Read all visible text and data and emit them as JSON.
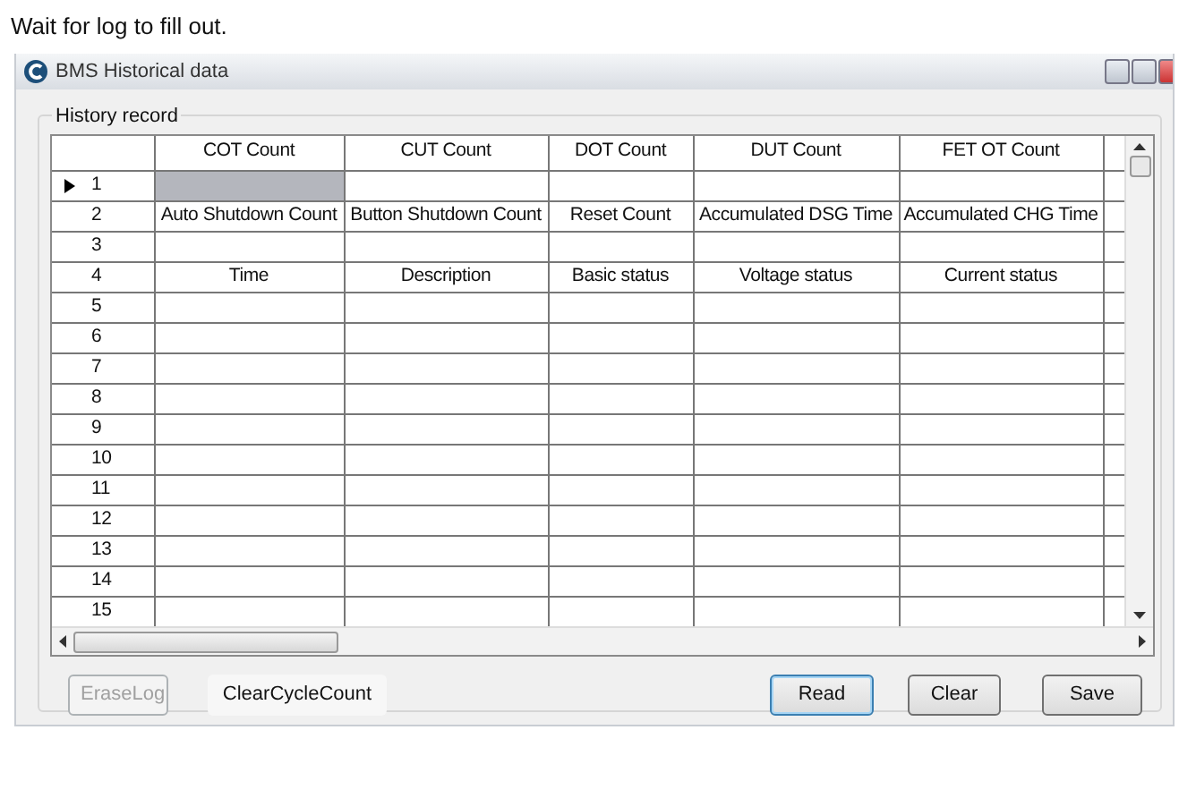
{
  "instruction": "Wait for log to fill out.",
  "window": {
    "title": "BMS Historical data"
  },
  "group": {
    "title": "History record"
  },
  "table": {
    "columns": [
      "COT Count",
      "CUT Count",
      "DOT Count",
      "DUT Count",
      "FET OT Count"
    ],
    "rows": [
      {
        "number": "1",
        "current": true
      },
      {
        "number": "2",
        "current": false,
        "cells": [
          "Auto Shutdown Count",
          "Button Shutdown Count",
          "Reset Count",
          "Accumulated DSG Time",
          "Accumulated CHG Time"
        ]
      },
      {
        "number": "3",
        "current": false
      },
      {
        "number": "4",
        "current": false,
        "cells": [
          "Time",
          "Description",
          "Basic status",
          "Voltage status",
          "Current status"
        ]
      },
      {
        "number": "5",
        "current": false
      },
      {
        "number": "6",
        "current": false
      },
      {
        "number": "7",
        "current": false
      },
      {
        "number": "8",
        "current": false
      },
      {
        "number": "9",
        "current": false
      },
      {
        "number": "10",
        "current": false
      },
      {
        "number": "11",
        "current": false
      },
      {
        "number": "12",
        "current": false
      },
      {
        "number": "13",
        "current": false
      },
      {
        "number": "14",
        "current": false
      },
      {
        "number": "15",
        "current": false
      }
    ]
  },
  "buttons": [
    {
      "label": "EraseLog",
      "kind": "standard",
      "disabled": true,
      "focused": false
    },
    {
      "label": "ClearCycleCount",
      "kind": "flat",
      "disabled": false,
      "focused": false
    },
    {
      "label": "Read",
      "kind": "standard",
      "disabled": false,
      "focused": true
    },
    {
      "label": "Clear",
      "kind": "standard",
      "disabled": false,
      "focused": false
    },
    {
      "label": "Save",
      "kind": "standard",
      "disabled": false,
      "focused": false
    }
  ]
}
